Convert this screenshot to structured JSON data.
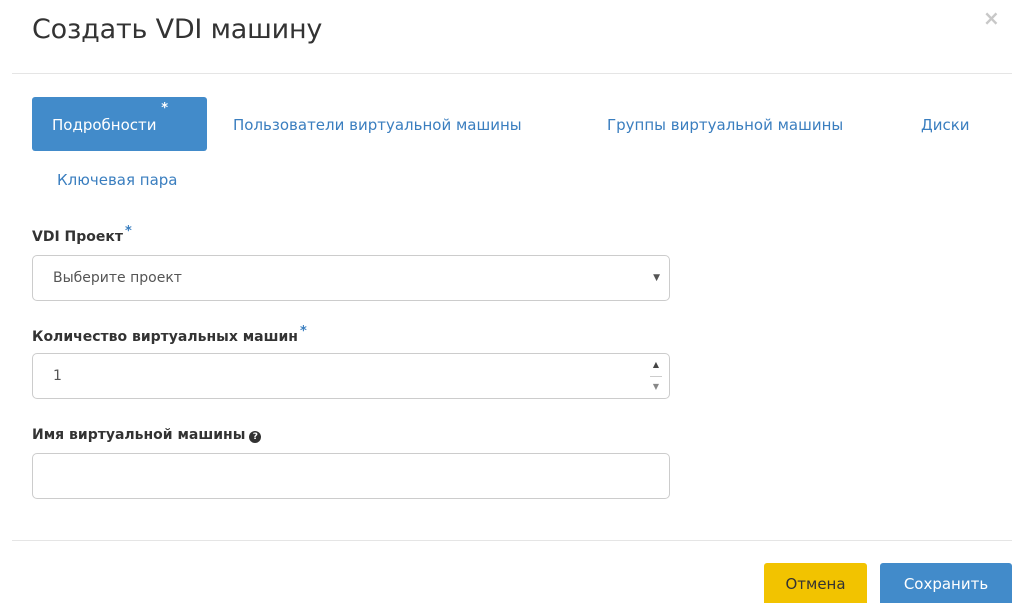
{
  "dialog": {
    "title": "Создать VDI машину",
    "close_label": "×"
  },
  "tabs": [
    {
      "label": "Подробности",
      "required": "*",
      "active": true
    },
    {
      "label": "Пользователи виртуальной машины",
      "active": false
    },
    {
      "label": "Группы виртуальной машины",
      "active": false
    },
    {
      "label": "Диски",
      "active": false
    },
    {
      "label": "Ключевая пара",
      "active": false
    }
  ],
  "form": {
    "project": {
      "label": "VDI Проект",
      "required": "*",
      "value": "Выберите проект",
      "arrow": "▼"
    },
    "count": {
      "label": "Количество виртуальных машин",
      "required": "*",
      "value": "1",
      "up": "▲",
      "down": "▼"
    },
    "name": {
      "label": "Имя виртуальной машины",
      "help_icon": "question-circle-icon",
      "help_glyph": "?",
      "value": ""
    }
  },
  "footer": {
    "cancel_label": "Отмена",
    "save_label": "Сохранить"
  },
  "colors": {
    "primary": "#428bca",
    "link": "#3a7ebf",
    "cancel": "#f2c300",
    "close_icon": "#c8c8c8"
  }
}
